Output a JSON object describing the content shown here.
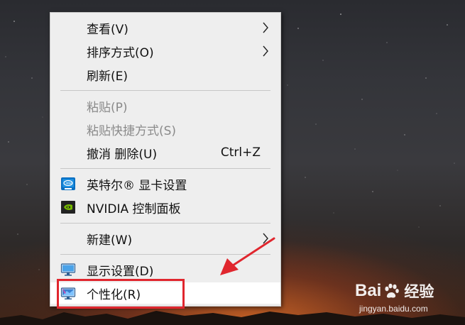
{
  "menu": {
    "items": [
      {
        "label": "查看(V)",
        "has_submenu": true,
        "enabled": true
      },
      {
        "label": "排序方式(O)",
        "has_submenu": true,
        "enabled": true
      },
      {
        "label": "刷新(E)",
        "has_submenu": false,
        "enabled": true
      },
      {
        "label": "粘贴(P)",
        "has_submenu": false,
        "enabled": false
      },
      {
        "label": "粘贴快捷方式(S)",
        "has_submenu": false,
        "enabled": false
      },
      {
        "label": "撤消 删除(U)",
        "shortcut": "Ctrl+Z",
        "has_submenu": false,
        "enabled": true
      },
      {
        "label": "英特尔® 显卡设置",
        "icon": "intel-graphics-icon",
        "enabled": true
      },
      {
        "label": "NVIDIA 控制面板",
        "icon": "nvidia-icon",
        "enabled": true
      },
      {
        "label": "新建(W)",
        "has_submenu": true,
        "enabled": true
      },
      {
        "label": "显示设置(D)",
        "icon": "display-settings-icon",
        "enabled": true
      },
      {
        "label": "个性化(R)",
        "icon": "personalize-icon",
        "enabled": true,
        "highlighted": true
      }
    ]
  },
  "annotation": {
    "box_color": "#e0262e",
    "arrow_color": "#e0262e"
  },
  "watermark": {
    "logo_text_1": "Bai",
    "logo_text_2": "经验",
    "url": "jingyan.baidu.com"
  },
  "colors": {
    "menu_bg": "#eeeeee",
    "hover_bg": "#ffffff",
    "disabled_text": "#8a8a8a",
    "separator": "#c7c7c7"
  }
}
